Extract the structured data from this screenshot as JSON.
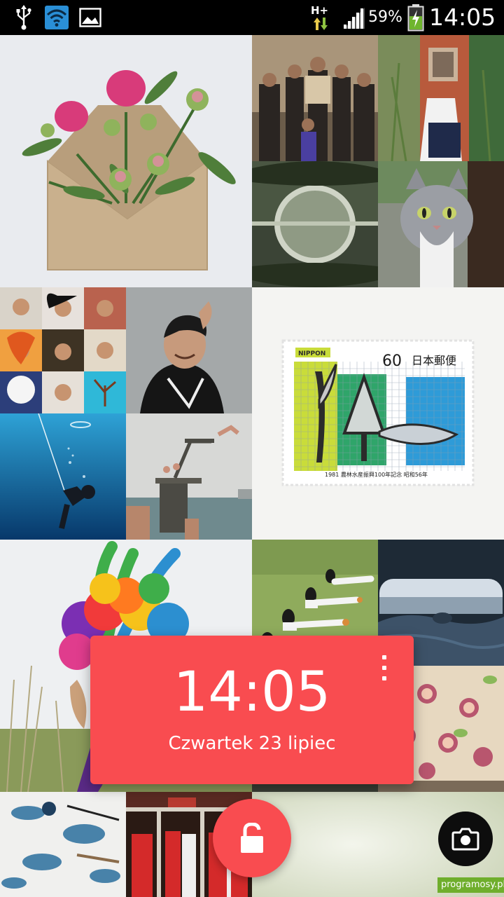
{
  "status_bar": {
    "icons": [
      "usb-icon",
      "wifi-icon",
      "image-icon",
      "network-type-icon",
      "signal-icon",
      "battery-icon"
    ],
    "network_type": "H+",
    "battery_percent": "59%",
    "battery_level": 0.59,
    "clock": "14:05"
  },
  "wallpaper_grid": {
    "tiles": [
      "envelope-peonies-photo",
      "group-portrait-photo",
      "woman-face-cover-photo",
      "stone-bridge-reflection-photo",
      "grey-cat-window-photo",
      "portrait-collage-photo",
      "young-man-portrait-photo",
      "japanese-stamp-photo",
      "underwater-diver-photo",
      "diving-tower-photo",
      "feathered-headdress-photo",
      "girls-stretching-photo",
      "bed-window-photo",
      "fig-tart-photo",
      "watercolor-desk-photo",
      "red-jerseys-locker-photo",
      "pale-green-sky-photo"
    ],
    "stamp": {
      "country": "NIPPON",
      "value": "60",
      "kanji": "日本郵便",
      "footer": "1981 農林水産振興100年記念 昭和56年"
    }
  },
  "lock_card": {
    "time": "14:05",
    "date": "Czwartek 23 lipiec",
    "accent_color": "#f94c50"
  },
  "actions": {
    "unlock_icon": "unlock-icon",
    "camera_icon": "camera-icon"
  },
  "watermark": "programosy.pl"
}
